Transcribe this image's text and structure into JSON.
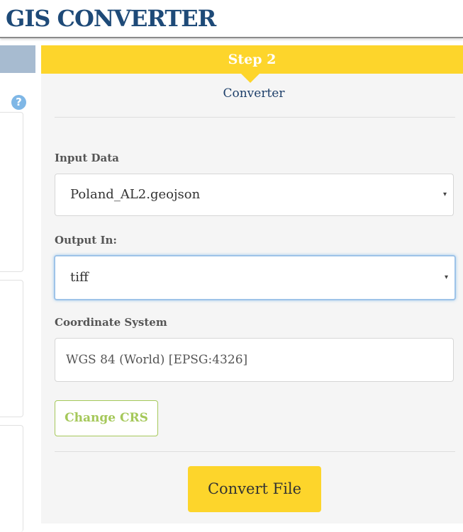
{
  "app": {
    "title": "GIS CONVERTER"
  },
  "left_panel": {
    "help_icon": "?"
  },
  "step": {
    "label": "Step 2",
    "subtitle": "Converter"
  },
  "form": {
    "input_data": {
      "label": "Input Data",
      "value": "Poland_AL2.geojson",
      "caret": "▾"
    },
    "output_in": {
      "label": "Output In:",
      "value": "tiff",
      "caret": "▾"
    },
    "coordinate_system": {
      "label": "Coordinate System",
      "value": "WGS 84 (World) [EPSG:4326]"
    },
    "change_crs_label": "Change CRS",
    "convert_label": "Convert File"
  },
  "colors": {
    "title": "#1e4a78",
    "step_bar": "#fdd52b",
    "accent_green": "#a5c85a",
    "focus_blue": "#9ec3e8"
  }
}
